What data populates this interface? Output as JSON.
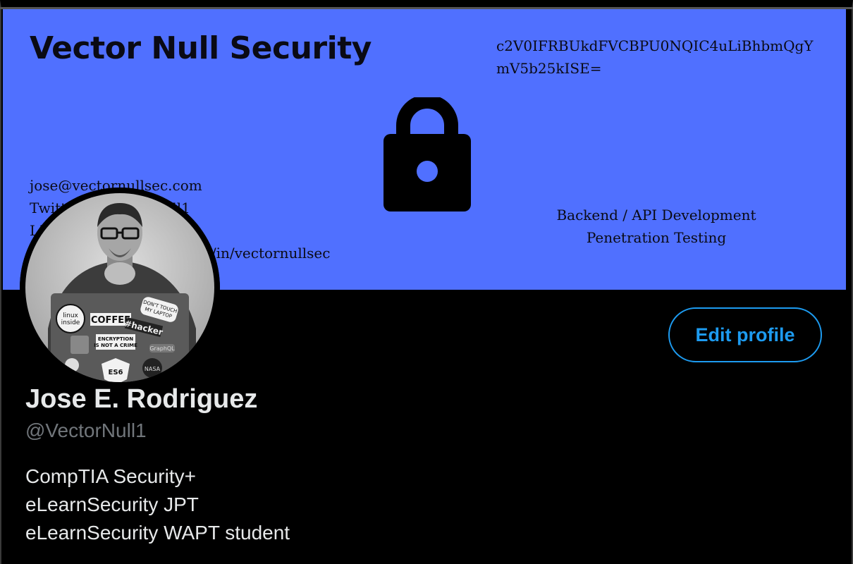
{
  "banner": {
    "title": "Vector Null Security",
    "code": "c2V0IFRBUkdFVCBPU0NQIC4uLiBhbmQgYmV5b25kISE=",
    "contact": [
      "jose@vectornullsec.com",
      "Twitter: @VectorNull1",
      "LinkedIn:",
      "https://www.linkedin.com/in/vectornullsec"
    ],
    "specialties": [
      "Backend / API Development",
      "Penetration Testing"
    ],
    "background_color": "#5070ff",
    "icon": "lock-icon"
  },
  "avatar": {
    "stickers": [
      "linux inside",
      "COFFEE",
      "#hacker",
      "DON'T TOUCH MY LAPTOP",
      "ENCRYPTION IS NOT A CRIME",
      "GraphQL",
      "ES6",
      "NASA"
    ]
  },
  "profile": {
    "edit_label": "Edit profile",
    "name": "Jose E. Rodriguez",
    "handle": "@VectorNull1",
    "bio": [
      "CompTIA Security+",
      "eLearnSecurity JPT",
      "eLearnSecurity WAPT student"
    ],
    "accent_color": "#1d9bf0"
  }
}
